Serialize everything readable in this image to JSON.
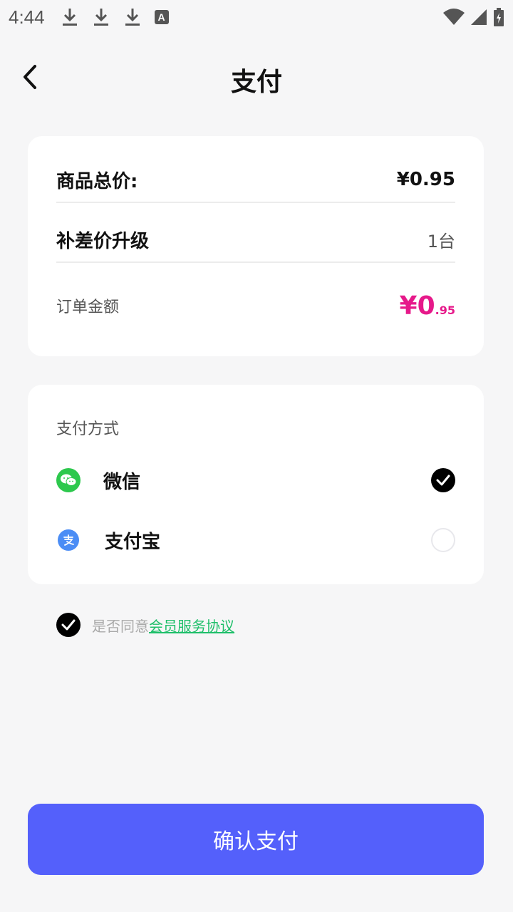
{
  "status_bar": {
    "time": "4:44",
    "left_icons": [
      "download-icon",
      "download-icon",
      "download-icon",
      "a-notification-icon"
    ],
    "a_icon_text": "A",
    "right_icons": [
      "wifi-icon",
      "signal-icon",
      "battery-icon"
    ]
  },
  "header": {
    "back_icon": "chevron-left-icon",
    "title": "支付"
  },
  "price_card": {
    "total_label": "商品总价:",
    "total_value": "¥0.95",
    "upgrade_label": "补差价升级",
    "upgrade_value": "1台",
    "order_label": "订单金额",
    "order_amount_main": "¥0",
    "order_amount_decimal": ".95"
  },
  "payment": {
    "title": "支付方式",
    "methods": [
      {
        "label": "微信",
        "icon": "wechat-icon",
        "selected": true
      },
      {
        "label": "支付宝",
        "icon": "alipay-icon",
        "selected": false
      }
    ]
  },
  "agreement": {
    "checked": true,
    "text": "是否同意",
    "link": "会员服务协议"
  },
  "confirm_button": "确认支付",
  "colors": {
    "accent": "#5460fb",
    "amount": "#e6198a",
    "link": "#1fbf6a",
    "wechat": "#2dc84d",
    "alipay": "#4b8df5",
    "background": "#f6f6f7"
  }
}
